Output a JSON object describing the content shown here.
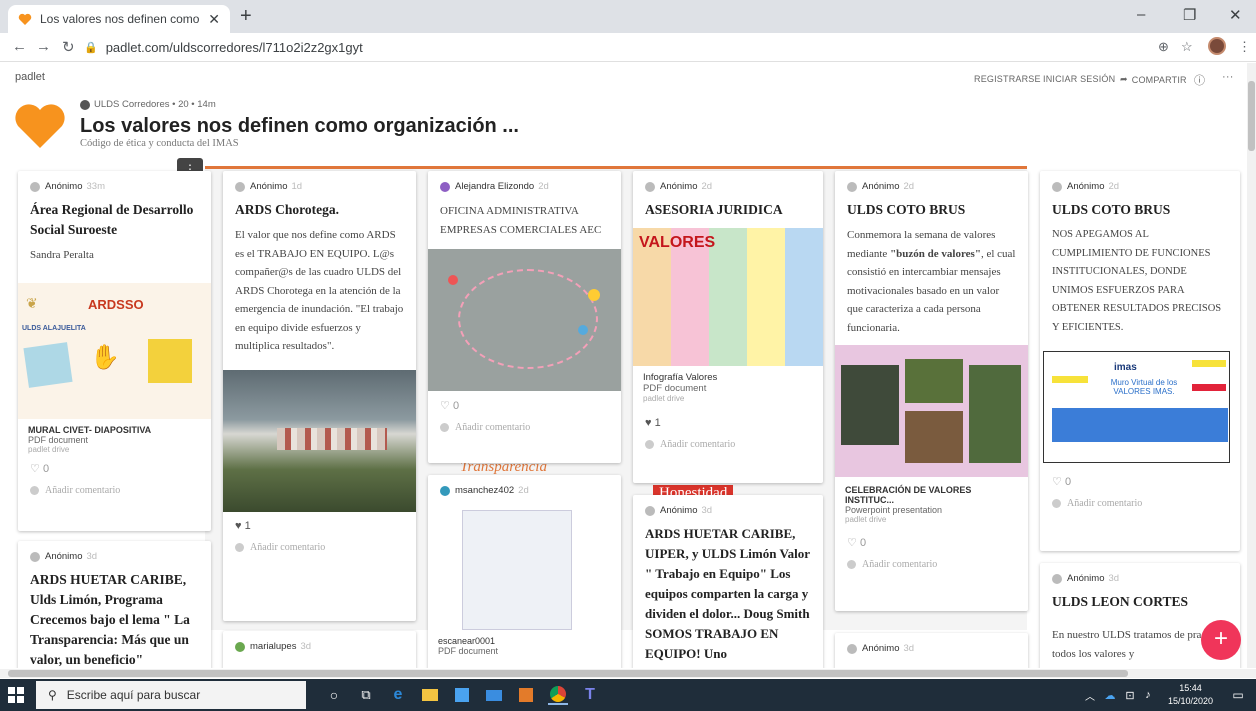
{
  "browser": {
    "tab_title": "Los valores nos definen como or",
    "tab_close": "✕",
    "new_tab": "+",
    "url": "padlet.com/uldscorredores/l711o2i2z2gx1gyt",
    "win_min": "–",
    "win_max": "❐",
    "win_close": "✕"
  },
  "padlet": {
    "logo": "padlet",
    "nav": {
      "register": "REGISTRARSE",
      "login": "INICIAR SESIÓN",
      "share": "COMPARTIR"
    },
    "owner": "ULDS Corredores",
    "meta_rest": "• 20 • 14m",
    "title": "Los valores nos definen como organización ...",
    "subtitle": "Código de ética y conducta del IMAS",
    "add_comment": "Añadir comentario"
  },
  "cards": {
    "c1": {
      "author": "Anónimo",
      "ago": "33m",
      "title": "Área Regional de Desarrollo Social Suroeste",
      "body": "Sandra Peralta",
      "img_brand": "ARDSSO",
      "img_sub": "ULDS ALAJUELITA",
      "att_title": "MURAL CIVET- DIAPOSITIVA",
      "att_type": "PDF document",
      "att_src": "padlet drive",
      "react": "0"
    },
    "c1b": {
      "author": "Anónimo",
      "ago": "3d",
      "title": "ARDS HUETAR CARIBE, Ulds Limón, Programa Crecemos  bajo el lema \" La Transparencia: Más que un valor, un beneficio\""
    },
    "c2": {
      "author": "Anónimo",
      "ago": "1d",
      "title": "ARDS Chorotega.",
      "body": "El valor que nos define como ARDS es el TRABAJO EN EQUIPO. L@s compañer@s de las cuadro ULDS del ARDS Chorotega en la atención de la emergencia de inundación. \"El trabajo en equipo divide esfuerzos y multiplica resultados\".",
      "react": "1"
    },
    "c2b": {
      "author": "marialupes",
      "ago": "3d"
    },
    "c3": {
      "author": "Alejandra Elizondo",
      "ago": "2d",
      "body": "OFICINA ADMINISTRATIVA EMPRESAS COMERCIALES AEC",
      "react": "0"
    },
    "c3b": {
      "author": "msanchez402",
      "ago": "2d",
      "att_title": "escanear0001",
      "att_type": "PDF document"
    },
    "bg_word1": "Transparencia",
    "bg_word2": "Honestidad",
    "c4": {
      "author": "Anónimo",
      "ago": "2d",
      "title": "ASESORIA JURIDICA",
      "img_word": "VALORES",
      "att_title": "Infografía Valores",
      "att_type": "PDF document",
      "att_src": "padlet drive",
      "react": "1"
    },
    "c4b": {
      "author": "Anónimo",
      "ago": "3d",
      "title": "ARDS HUETAR CARIBE, UIPER, y  ULDS  Limón Valor \" Trabajo en  Equipo\" Los equipos comparten la carga y dividen el dolor... Doug Smith  SOMOS TRABAJO EN EQUIPO!  Uno"
    },
    "c5": {
      "author": "Anónimo",
      "ago": "2d",
      "title": "ULDS COTO BRUS",
      "body_a": "Conmemora la semana de valores mediante ",
      "body_bold": "\"buzón de valores\"",
      "body_b": ", el cual consistió en intercambiar mensajes motivacionales basado en un valor que caracteriza a cada persona funcionaria.",
      "att_title": "CELEBRACIÓN DE VALORES INSTITUC...",
      "att_type": "Powerpoint presentation",
      "att_src": "padlet drive",
      "react": "0"
    },
    "c5b": {
      "author": "Anónimo",
      "ago": "3d"
    },
    "c6": {
      "author": "Anónimo",
      "ago": "2d",
      "title": "ULDS COTO BRUS",
      "body": "NOS APEGAMOS AL CUMPLIMIENTO DE FUNCIONES INSTITUCIONALES, DONDE UNIMOS ESFUERZOS PARA OBTENER RESULTADOS PRECISOS Y EFICIENTES.",
      "img_brand": "imas",
      "img_title": "Muro Virtual de los VALORES IMAS.",
      "react": "0"
    },
    "c6b": {
      "author": "Anónimo",
      "ago": "3d",
      "title": "ULDS LEON CORTES",
      "body": "En nuestro ULDS  tratamos de practicar todos  los valores y"
    }
  },
  "taskbar": {
    "search": "Escribe aquí para buscar",
    "time": "15:44",
    "date": "15/10/2020"
  },
  "colors": {
    "accent": "#e0763a",
    "fab": "#f0355a",
    "taskbar": "#1f2d3a"
  }
}
